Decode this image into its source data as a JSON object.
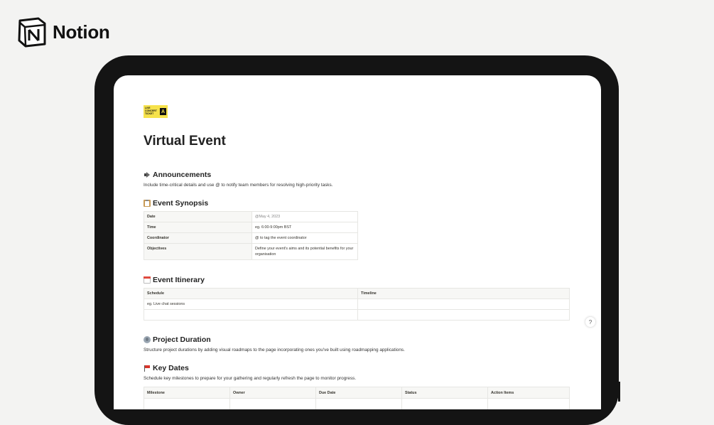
{
  "brand": {
    "name": "Notion",
    "logo_letter": "N"
  },
  "cover": {
    "lines": [
      "LIVE",
      "CONCERT",
      "TICKET",
      "--------",
      "2000 SEATS  -  20 AUG"
    ],
    "badge": "A"
  },
  "page": {
    "title": "Virtual Event"
  },
  "sections": {
    "announcements": {
      "icon": "megaphone-icon",
      "heading": "Announcements",
      "description": "Include time-critical details and use @ to notify team members for resolving high-priority tasks."
    },
    "synopsis": {
      "icon": "clipboard-icon",
      "heading": "Event Synopsis",
      "rows": [
        {
          "label": "Date",
          "value": "@May 4, 2023"
        },
        {
          "label": "Time",
          "value": "eg. 6:00-9:00pm BST"
        },
        {
          "label": "Coordinator",
          "value": "@ to tag the event coordinator"
        },
        {
          "label": "Objectives",
          "value": "Define your event's aims and its potential benefits for your organisation"
        }
      ]
    },
    "itinerary": {
      "icon": "calendar-icon",
      "heading": "Event Itinerary",
      "columns": [
        "Schedule",
        "Timeline"
      ],
      "rows": [
        [
          "eg. Live chat sessions",
          ""
        ],
        [
          "",
          ""
        ]
      ]
    },
    "duration": {
      "icon": "globe-icon",
      "heading": "Project Duration",
      "description": "Structure project durations by adding visual roadmaps to the page incorporating ones you've built using roadmapping applications."
    },
    "key_dates": {
      "icon": "red-flag-icon",
      "heading": "Key Dates",
      "description": "Schedule key milestones to prepare for your gathering and regularly refresh the page to monitor progress.",
      "columns": [
        "Milestone",
        "Owner",
        "Due Date",
        "Status",
        "Action Items"
      ]
    }
  },
  "help": {
    "label": "?"
  }
}
